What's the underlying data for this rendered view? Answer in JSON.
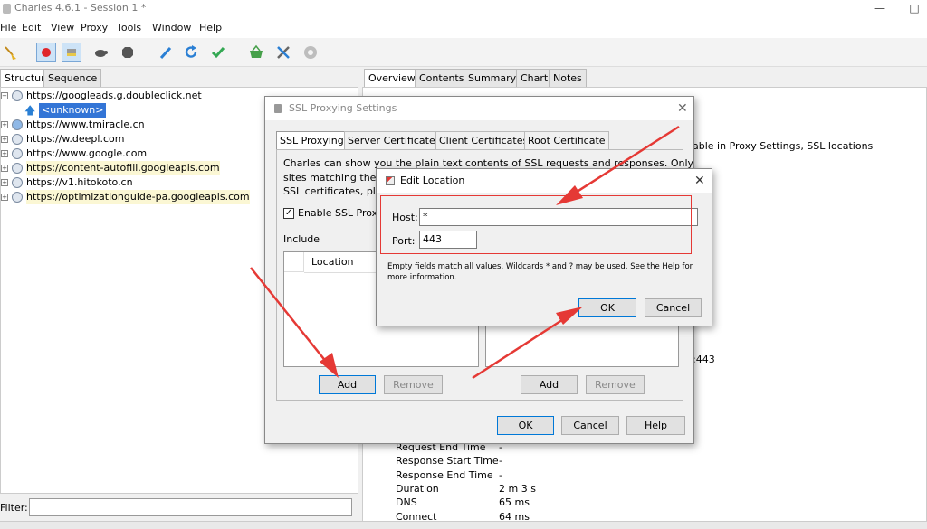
{
  "window": {
    "title": "Charles 4.6.1 - Session 1 *"
  },
  "menu": [
    "File",
    "Edit",
    "View",
    "Proxy",
    "Tools",
    "Window",
    "Help"
  ],
  "toolbar_icons": [
    "broom-icon",
    "record-icon",
    "throttle-icon",
    "turtle-icon",
    "stop-icon",
    "pen-icon",
    "refresh-icon",
    "check-icon",
    "basket-icon",
    "tools-icon",
    "gear-icon"
  ],
  "left": {
    "tabs": [
      "Structure",
      "Sequence"
    ],
    "tree": [
      {
        "label": "https://googleads.g.doubleclick.net",
        "expanded": true,
        "highlight": false
      },
      {
        "label": "<unknown>",
        "child": true
      },
      {
        "label": "https://www.tmiracle.cn",
        "highlight": false
      },
      {
        "label": "https://w.deepl.com",
        "highlight": false
      },
      {
        "label": "https://www.google.com",
        "highlight": false
      },
      {
        "label": "https://content-autofill.googleapis.com",
        "highlight": true
      },
      {
        "label": "https://v1.hitokoto.cn",
        "highlight": false
      },
      {
        "label": "https://optimizationguide-pa.googleapis.com",
        "highlight": true
      }
    ],
    "filter_label": "Filter:"
  },
  "right": {
    "tabs": [
      "Overview",
      "Contents",
      "Summary",
      "Chart",
      "Notes"
    ],
    "frag_text": "able in Proxy Settings, SSL locations",
    "frag_port": ":443",
    "rows": [
      {
        "k": "Request End Time",
        "v": "-"
      },
      {
        "k": "Response Start Time",
        "v": "-"
      },
      {
        "k": "Response End Time",
        "v": "-"
      },
      {
        "k": "Duration",
        "v": "2 m 3 s"
      },
      {
        "k": "DNS",
        "v": "65 ms"
      },
      {
        "k": "Connect",
        "v": "64 ms"
      }
    ]
  },
  "ssl": {
    "title": "SSL Proxying Settings",
    "tabs": [
      "SSL Proxying",
      "Server Certificates",
      "Client Certificates",
      "Root Certificate"
    ],
    "desc1": "Charles can show you the plain text contents of SSL requests and responses. Only",
    "desc2": "sites matching the lo",
    "desc3": "SSL certificates, plea",
    "enable": "Enable SSL Proxyi",
    "include": "Include",
    "col_location": "Location",
    "add": "Add",
    "remove": "Remove",
    "ok": "OK",
    "cancel": "Cancel",
    "help": "Help"
  },
  "edit": {
    "title": "Edit Location",
    "host_label": "Host:",
    "host_value": "*",
    "port_label": "Port:",
    "port_value": "443",
    "note1": "Empty fields match all values. Wildcards * and ? may be used. See the Help for",
    "note2": "more information.",
    "ok": "OK",
    "cancel": "Cancel"
  },
  "annotation_color": "#e53935"
}
